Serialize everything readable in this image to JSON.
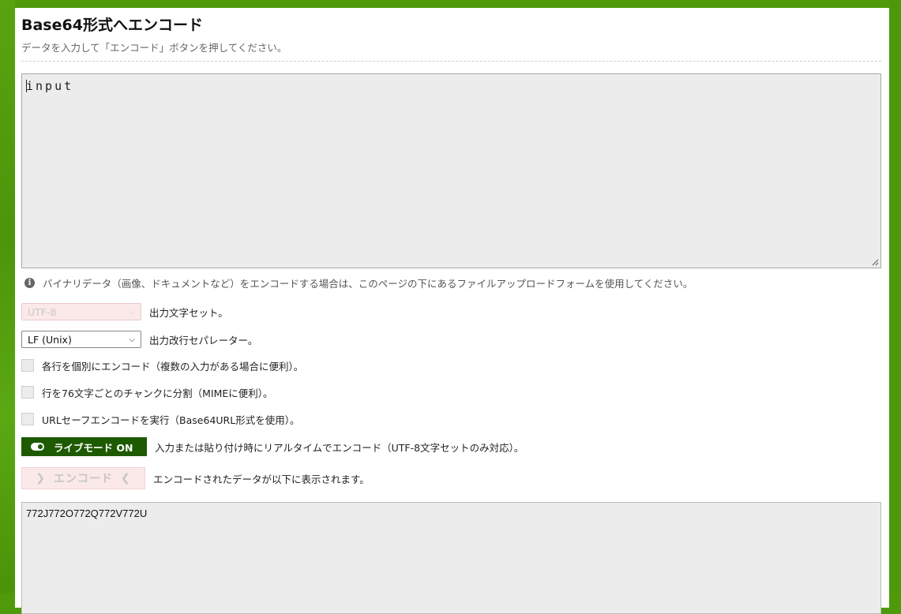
{
  "page": {
    "title": "Base64形式へエンコード",
    "subtitle": "データを入力して「エンコード」ボタンを押してください。"
  },
  "input": {
    "value": "input"
  },
  "info": {
    "icon": "info-icon",
    "text": "バイナリデータ（画像、ドキュメントなど）をエンコードする場合は、このページの下にあるファイルアップロードフォームを使用してください。"
  },
  "options": {
    "charset": {
      "value": "UTF-8",
      "label": "出力文字セット。",
      "disabled": true
    },
    "newline": {
      "value": "LF (Unix)",
      "label": "出力改行セパレーター。"
    },
    "checkbox_each_line": {
      "label": "各行を個別にエンコード（複数の入力がある場合に便利）。",
      "checked": false
    },
    "checkbox_split_76": {
      "label": "行を76文字ごとのチャンクに分割（MIMEに便利）。",
      "checked": false
    },
    "checkbox_url_safe": {
      "label": "URLセーフエンコードを実行（Base64URL形式を使用）。",
      "checked": false
    }
  },
  "live_mode": {
    "button_label": "ライブモード ON",
    "description": "入力または貼り付け時にリアルタイムでエンコード（UTF-8文字セットのみ対応）。"
  },
  "encode": {
    "button_label": "エンコード",
    "description": "エンコードされたデータが以下に表示されます。"
  },
  "output": {
    "value": "772J772O772Q772V772U"
  },
  "colors": {
    "background_green": "#4f9a0b",
    "live_button": "#1e5a00",
    "disabled_pink": "#fbe9e9"
  }
}
